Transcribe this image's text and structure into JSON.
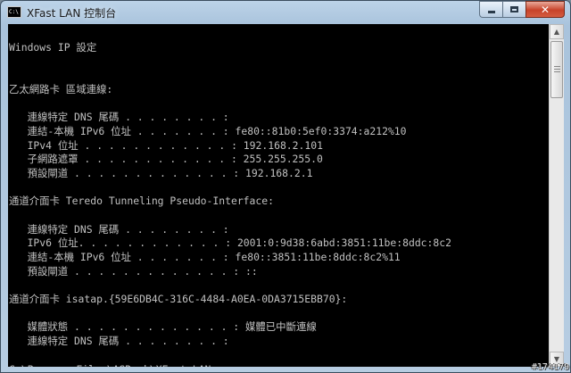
{
  "window": {
    "title": "XFast LAN 控制台",
    "app_icon_text": "C:\\",
    "minimize_icon": "minimize-icon",
    "maximize_icon": "maximize-icon",
    "close_icon": "close-icon",
    "close_label": "✕"
  },
  "console": {
    "lines": [
      "",
      "Windows IP 設定",
      "",
      "",
      "乙太網路卡 區域連線:",
      "",
      "   連線特定 DNS 尾碼 . . . . . . . . :",
      "   連結-本機 IPv6 位址 . . . . . . . : fe80::81b0:5ef0:3374:a212%10",
      "   IPv4 位址 . . . . . . . . . . . . : 192.168.2.101",
      "   子網路遮罩 . . . . . . . . . . . . : 255.255.255.0",
      "   預設閘道 . . . . . . . . . . . . . : 192.168.2.1",
      "",
      "通道介面卡 Teredo Tunneling Pseudo-Interface:",
      "",
      "   連線特定 DNS 尾碼 . . . . . . . . :",
      "   IPv6 位址. . . . . . . . . . . . : 2001:0:9d38:6abd:3851:11be:8ddc:8c2",
      "   連結-本機 IPv6 位址 . . . . . . . : fe80::3851:11be:8ddc:8c2%11",
      "   預設閘道 . . . . . . . . . . . . . : ::",
      "",
      "通道介面卡 isatap.{59E6DB4C-316C-4484-A0EA-0DA3715EBB70}:",
      "",
      "   媒體狀態 . . . . . . . . . . . . . : 媒體已中斷連線",
      "   連線特定 DNS 尾碼 . . . . . . . . :",
      "",
      "C:\\Program Files\\ASRock\\XFast LAN>"
    ]
  },
  "scrollbar": {
    "up_icon": "scroll-up-arrow-icon",
    "down_icon": "scroll-down-arrow-icon",
    "up_glyph": "▲",
    "down_glyph": "▼"
  },
  "watermark": "#174179"
}
